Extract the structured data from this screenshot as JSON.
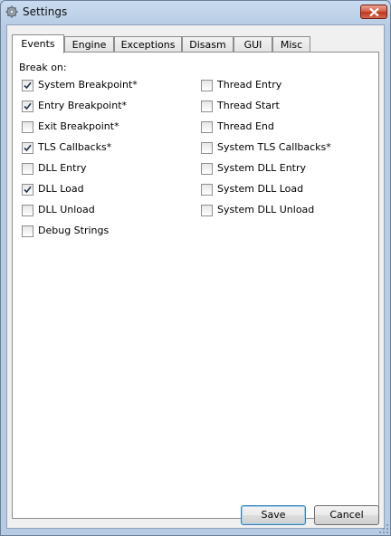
{
  "window": {
    "title": "Settings"
  },
  "tabs": [
    {
      "label": "Events",
      "active": true
    },
    {
      "label": "Engine",
      "active": false
    },
    {
      "label": "Exceptions",
      "active": false
    },
    {
      "label": "Disasm",
      "active": false
    },
    {
      "label": "GUI",
      "active": false
    },
    {
      "label": "Misc",
      "active": false
    }
  ],
  "events": {
    "section_label": "Break on:",
    "left_column": [
      {
        "label": "System Breakpoint*",
        "checked": true
      },
      {
        "label": "Entry Breakpoint*",
        "checked": true
      },
      {
        "label": "Exit Breakpoint*",
        "checked": false
      },
      {
        "label": "TLS Callbacks*",
        "checked": true
      },
      {
        "label": "DLL Entry",
        "checked": false
      },
      {
        "label": "DLL Load",
        "checked": true
      },
      {
        "label": "DLL Unload",
        "checked": false
      },
      {
        "label": "Debug Strings",
        "checked": false
      }
    ],
    "right_column": [
      {
        "label": "Thread Entry",
        "checked": false
      },
      {
        "label": "Thread Start",
        "checked": false
      },
      {
        "label": "Thread End",
        "checked": false
      },
      {
        "label": "System TLS Callbacks*",
        "checked": false
      },
      {
        "label": "System DLL Entry",
        "checked": false
      },
      {
        "label": "System DLL Load",
        "checked": false
      },
      {
        "label": "System DLL Unload",
        "checked": false
      }
    ]
  },
  "buttons": {
    "save": "Save",
    "cancel": "Cancel"
  },
  "icons": {
    "title": "gear-icon",
    "close": "close-icon",
    "check": "checkmark-icon",
    "grip": "resize-grip-icon"
  }
}
